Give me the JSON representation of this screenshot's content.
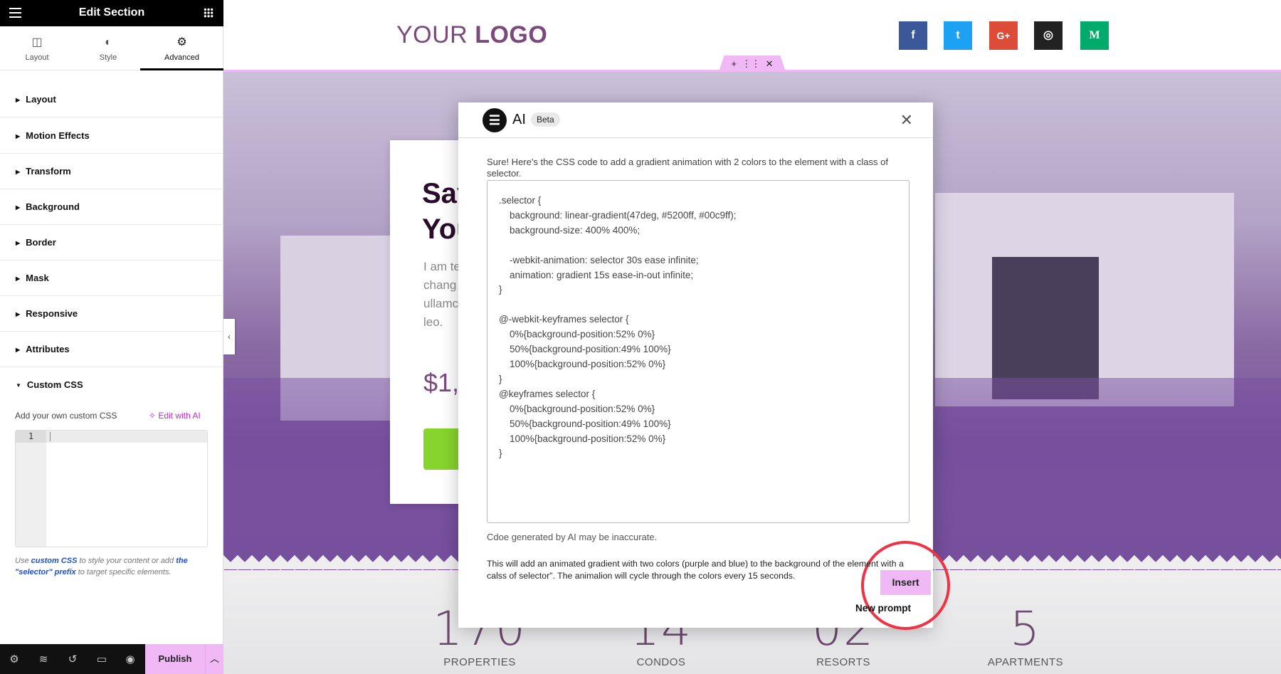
{
  "sidebar": {
    "title": "Edit Section",
    "tabs": [
      {
        "label": "Layout",
        "icon": "columns-icon"
      },
      {
        "label": "Style",
        "icon": "half-circle-icon"
      },
      {
        "label": "Advanced",
        "icon": "gear-icon",
        "active": true
      }
    ],
    "sections": [
      {
        "label": "Layout",
        "expanded": false
      },
      {
        "label": "Motion Effects",
        "expanded": false
      },
      {
        "label": "Transform",
        "expanded": false
      },
      {
        "label": "Background",
        "expanded": false
      },
      {
        "label": "Border",
        "expanded": false
      },
      {
        "label": "Mask",
        "expanded": false
      },
      {
        "label": "Responsive",
        "expanded": false
      },
      {
        "label": "Attributes",
        "expanded": false
      },
      {
        "label": "Custom CSS",
        "expanded": true
      }
    ],
    "custom_css": {
      "label": "Add your own custom CSS",
      "edit_ai": "Edit with AI",
      "line_number": "1",
      "help_prefix": "Use ",
      "help_link1": "custom CSS",
      "help_mid": " to style your content or add ",
      "help_link2": "the \"selector\" prefix",
      "help_suffix": " to target specific elements."
    },
    "footer": {
      "publish": "Publish"
    }
  },
  "site": {
    "logo_light": "YOUR ",
    "logo_bold": "LOGO",
    "social": [
      {
        "name": "facebook",
        "glyph": "f",
        "color": "#3b5998"
      },
      {
        "name": "twitter",
        "glyph": "t",
        "color": "#1da1f2"
      },
      {
        "name": "google-plus",
        "glyph": "G+",
        "color": "#dd4b39"
      },
      {
        "name": "instagram",
        "glyph": "◎",
        "color": "#222222"
      },
      {
        "name": "medium",
        "glyph": "M",
        "color": "#00ab6c"
      }
    ],
    "hero": {
      "heading": "Say\nYou",
      "text": "I am te\nchang\nullamc\nleo.",
      "price": "$1,"
    },
    "stats": [
      {
        "num": "170",
        "label": "PROPERTIES"
      },
      {
        "num": "14",
        "label": "CONDOS"
      },
      {
        "num": "02",
        "label": "RESORTS"
      },
      {
        "num": "5",
        "label": "APARTMENTS"
      }
    ]
  },
  "ai_modal": {
    "title": "AI",
    "badge": "Beta",
    "intro": "Sure! Here's the CSS code to add a gradient animation with 2 colors to the element with a class of selector.",
    "code": ".selector {\n    background: linear-gradient(47deg, #5200ff, #00c9ff);\n    background-size: 400% 400%;\n\n    -webkit-animation: selector 30s ease infinite;\n    animation: gradient 15s ease-in-out infinite;\n}\n\n@-webkit-keyframes selector {\n    0%{background-position:52% 0%}\n    50%{background-position:49% 100%}\n    100%{background-position:52% 0%}\n}\n@keyframes selector {\n    0%{background-position:52% 0%}\n    50%{background-position:49% 100%}\n    100%{background-position:52% 0%}\n}",
    "insert": "Insert",
    "disclaimer": "Cdoe generated by AI may be inaccurate.",
    "summary": "This will add an animated gradient with two colors (purple and blue) to the background of the element with a calss of selector\". The animalion will cycle through the colors every 15 seconds.",
    "new_prompt": "New prompt"
  },
  "colors": {
    "accent": "#f0b8f5",
    "highlight_ring": "#ee3344",
    "ai_link": "#c026d3"
  }
}
